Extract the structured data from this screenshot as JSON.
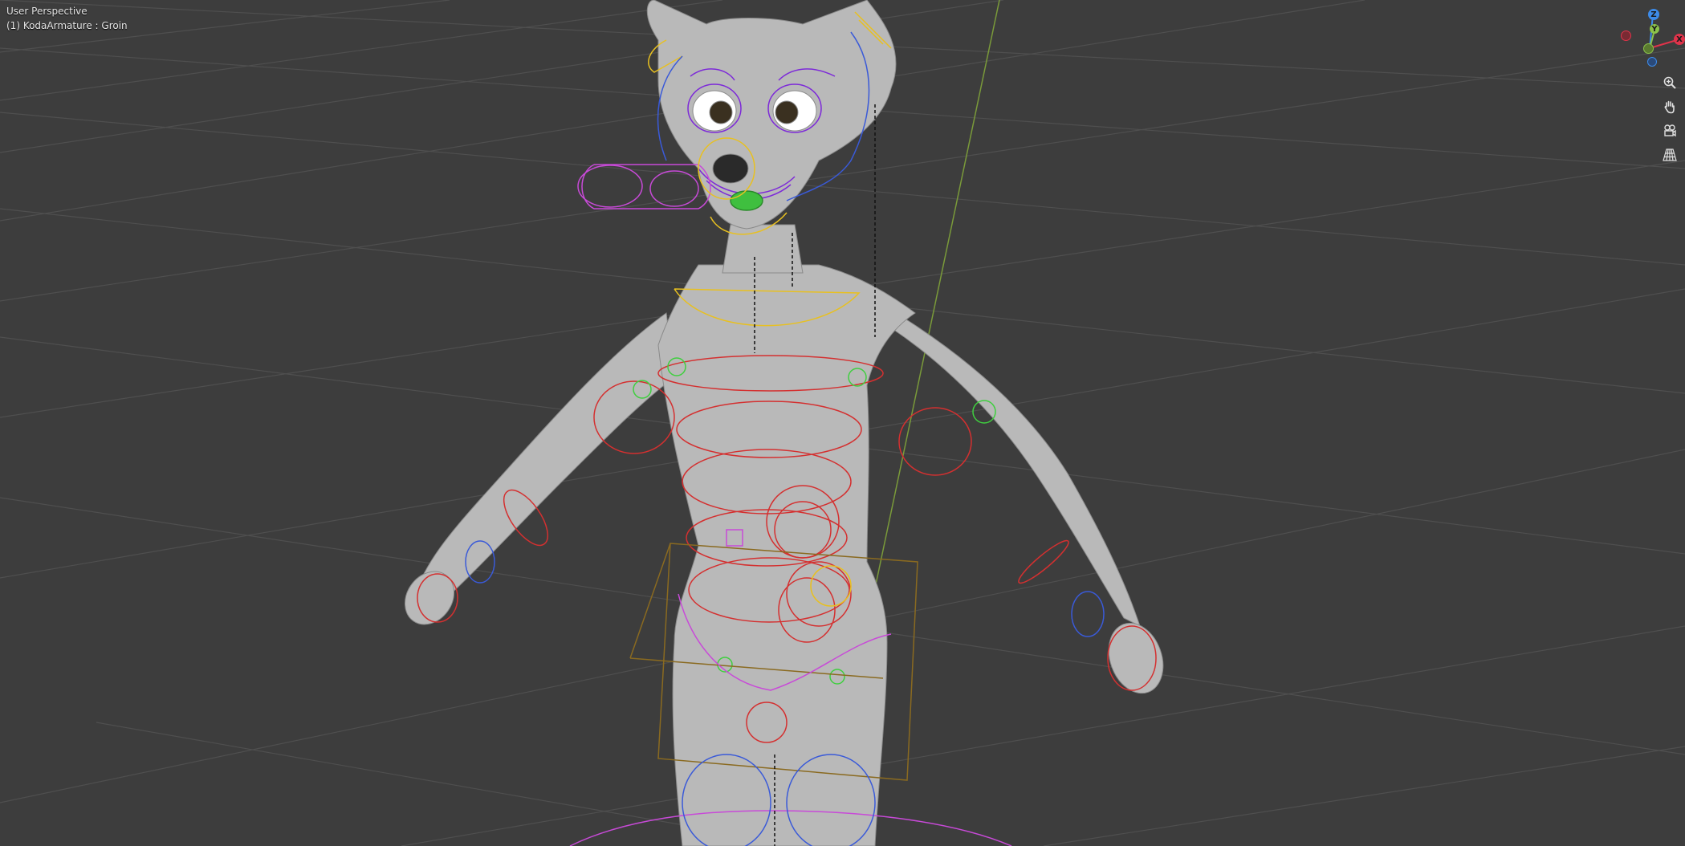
{
  "viewport": {
    "view_name": "User Perspective",
    "object_info": "(1) KodaArmature : Groin"
  },
  "nav_gizmo": {
    "axes": {
      "x": "X",
      "y": "Y",
      "z": "Z"
    },
    "colors": {
      "x": "#e0334a",
      "y": "#8bc34a",
      "z": "#3d8be8",
      "bg": "#3d3d3d",
      "grid": "#4a4a4a"
    }
  },
  "nav_buttons": [
    {
      "name": "zoom-button",
      "icon": "magnifier-plus-icon"
    },
    {
      "name": "pan-button",
      "icon": "hand-icon"
    },
    {
      "name": "camera-view-button",
      "icon": "camera-icon"
    },
    {
      "name": "perspective-toggle-button",
      "icon": "grid-perspective-icon"
    }
  ]
}
